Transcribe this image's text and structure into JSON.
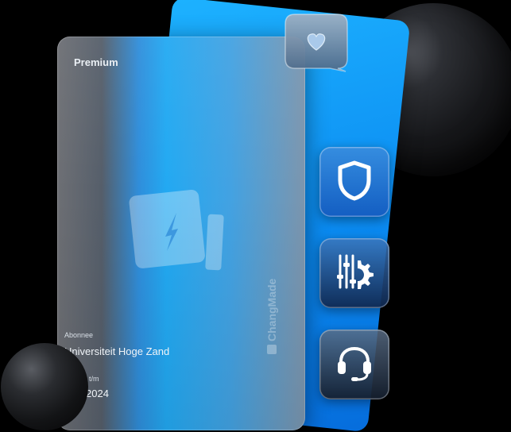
{
  "card": {
    "tier_label": "Premium",
    "subscriber_label": "Abonnee",
    "subscriber_name": "Universiteit Hoge Zand",
    "valid_label": "t/m",
    "valid_value": "2024",
    "brand_name": "ChangMade"
  },
  "icons": {
    "chat": "heart-chat-icon",
    "security": "shield-icon",
    "settings": "settings-sliders-gear-icon",
    "support": "headset-icon"
  },
  "colors": {
    "card_blue": "#0b8cf2",
    "accent_blue": "#22a9f2",
    "background": "#000000"
  }
}
